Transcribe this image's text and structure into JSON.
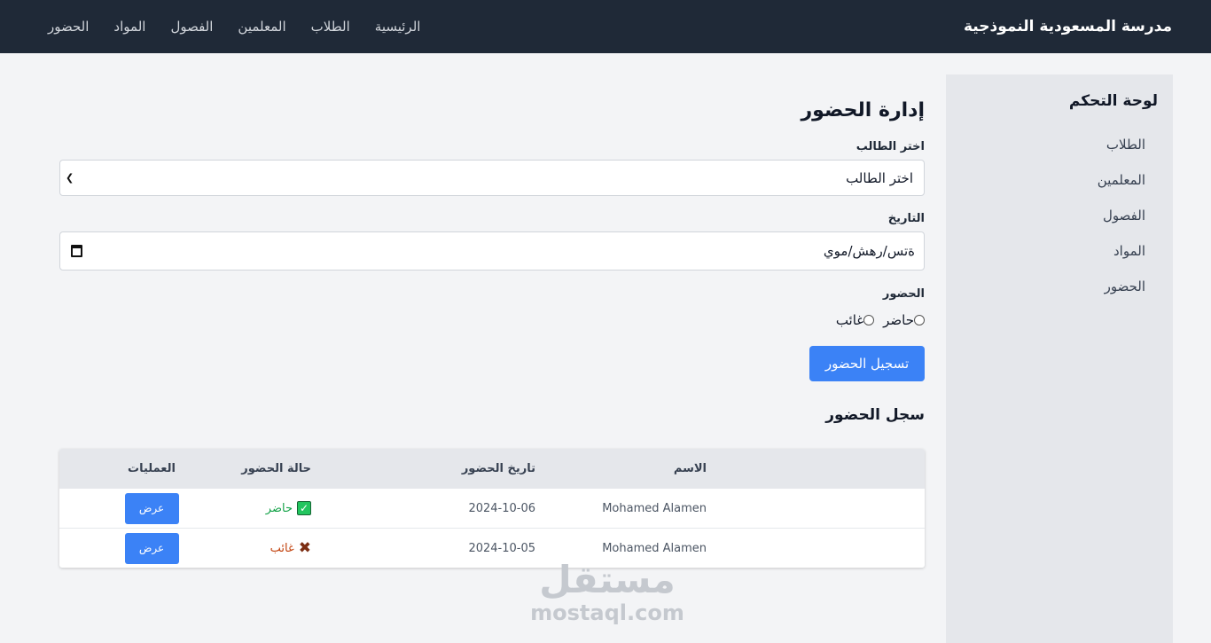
{
  "navbar": {
    "brand": "مدرسة المسعودية النموذجية",
    "links": [
      "الرئيسية",
      "الطلاب",
      "المعلمين",
      "الفصول",
      "المواد",
      "الحضور"
    ]
  },
  "sidebar": {
    "title": "لوحة التحكم",
    "items": [
      "الطلاب",
      "المعلمين",
      "الفصول",
      "المواد",
      "الحضور"
    ]
  },
  "main": {
    "title": "إدارة الحضور",
    "student_label": "اختر الطالب",
    "student_select_value": "اختر الطالب",
    "date_label": "التاريخ",
    "date_value": "ةتس/رهش/موي",
    "attendance_label": "الحضور",
    "radio_present": "حاضر",
    "radio_absent": "غائب",
    "submit_label": "تسجيل الحضور",
    "log_title": "سجل الحضور"
  },
  "table": {
    "headers": [
      "الاسم",
      "تاريخ الحضور",
      "حالة الحضور",
      "العمليات"
    ],
    "rows": [
      {
        "name": "Mohamed Alamen",
        "date": "2024-10-06",
        "status": "حاضر",
        "action": "عرض"
      },
      {
        "name": "Mohamed Alamen",
        "date": "2024-10-05",
        "status": "غائب",
        "action": "عرض"
      }
    ]
  },
  "watermark": {
    "arabic": "مستقل",
    "latin": "mostaql.com"
  },
  "colors": {
    "navbar": "#1f2937",
    "accent": "#3b82f6",
    "present": "#16a34a",
    "absent": "#c2410c"
  }
}
